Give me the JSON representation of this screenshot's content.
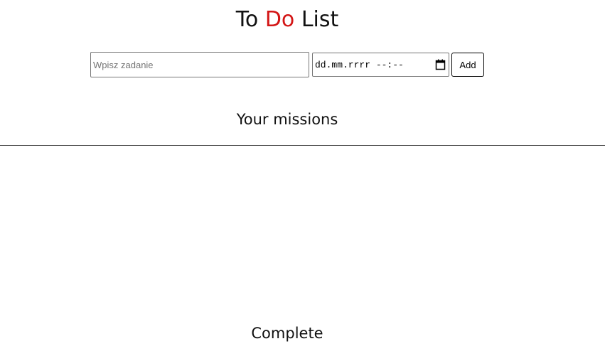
{
  "header": {
    "title_part1": "To ",
    "title_accent": "Do",
    "title_part2": " List",
    "accent_color": "#d31515"
  },
  "form": {
    "task_placeholder": "Wpisz zadanie",
    "task_value": "",
    "date_placeholder": "dd.mm.rrrr --:--",
    "date_icon": "calendar-icon",
    "add_label": "Add"
  },
  "sections": {
    "missions_title": "Your missions",
    "missions_items": [],
    "complete_title": "Complete"
  }
}
